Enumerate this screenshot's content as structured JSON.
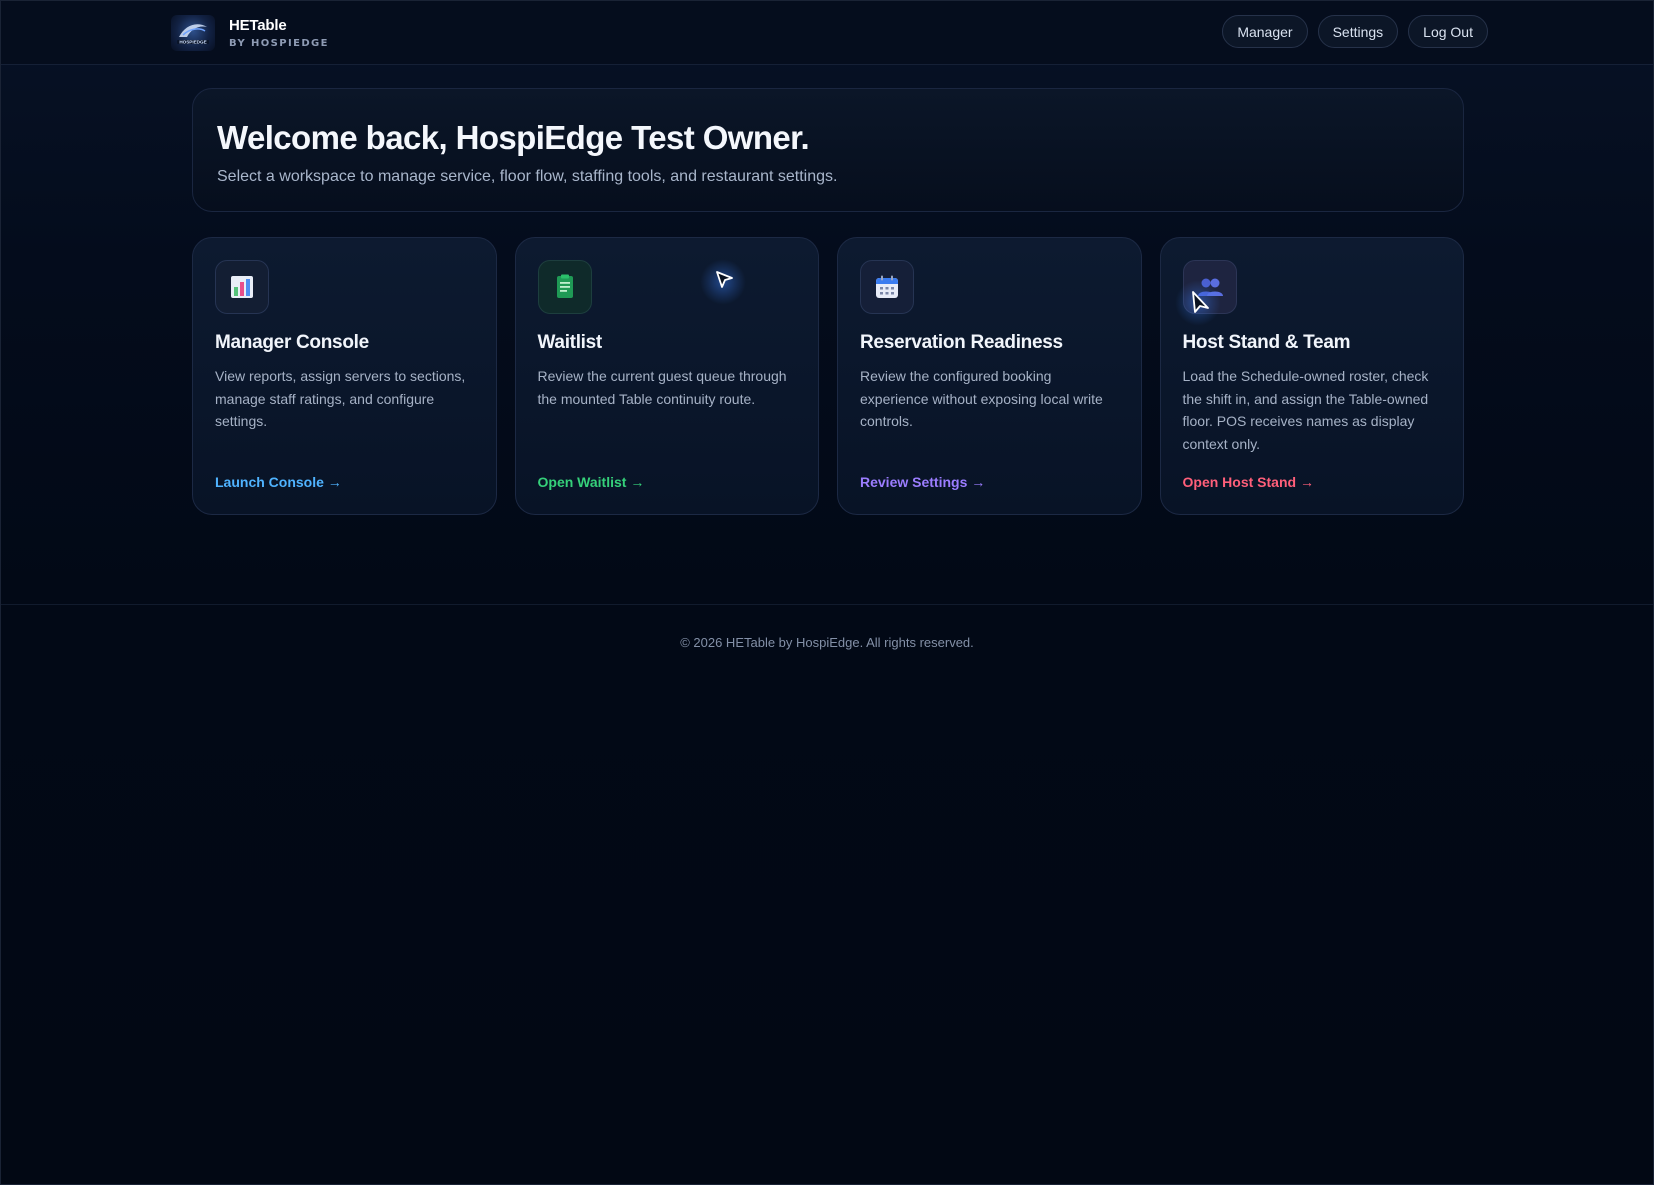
{
  "brand": {
    "name": "HETable",
    "subtitle": "BY HOSPIEDGE",
    "logo_icon": "hospiedge-logo-icon"
  },
  "nav": {
    "manager": "Manager",
    "settings": "Settings",
    "logout": "Log Out"
  },
  "hero": {
    "title": "Welcome back, HospiEdge Test Owner.",
    "subtitle": "Select a workspace to manage service, floor flow, staffing tools, and restaurant settings."
  },
  "cards": [
    {
      "icon": "bar-chart-icon",
      "title": "Manager Console",
      "description": "View reports, assign servers to sections, manage staff ratings, and configure settings.",
      "cta": "Launch Console →",
      "accent": "#4fb3ff"
    },
    {
      "icon": "clipboard-list-icon",
      "title": "Waitlist",
      "description": "Review the current guest queue through the mounted Table continuity route.",
      "cta": "Open Waitlist →",
      "accent": "#35d07a"
    },
    {
      "icon": "calendar-icon",
      "title": "Reservation Readiness",
      "description": "Review the configured booking experience without exposing local write controls.",
      "cta": "Review Settings →",
      "accent": "#9b7dff"
    },
    {
      "icon": "team-icon",
      "title": "Host Stand & Team",
      "description": "Load the Schedule-owned roster, check the shift in, and assign the Table-owned floor. POS receives names as display context only.",
      "cta": "Open Host Stand →",
      "accent": "#ff5f7a"
    }
  ],
  "footer": {
    "copyright": "© 2026 HETable by HospiEdge. All rights reserved."
  },
  "colors": {
    "background": "#020916",
    "card": "#0d1a30",
    "border": "#1c2944"
  }
}
